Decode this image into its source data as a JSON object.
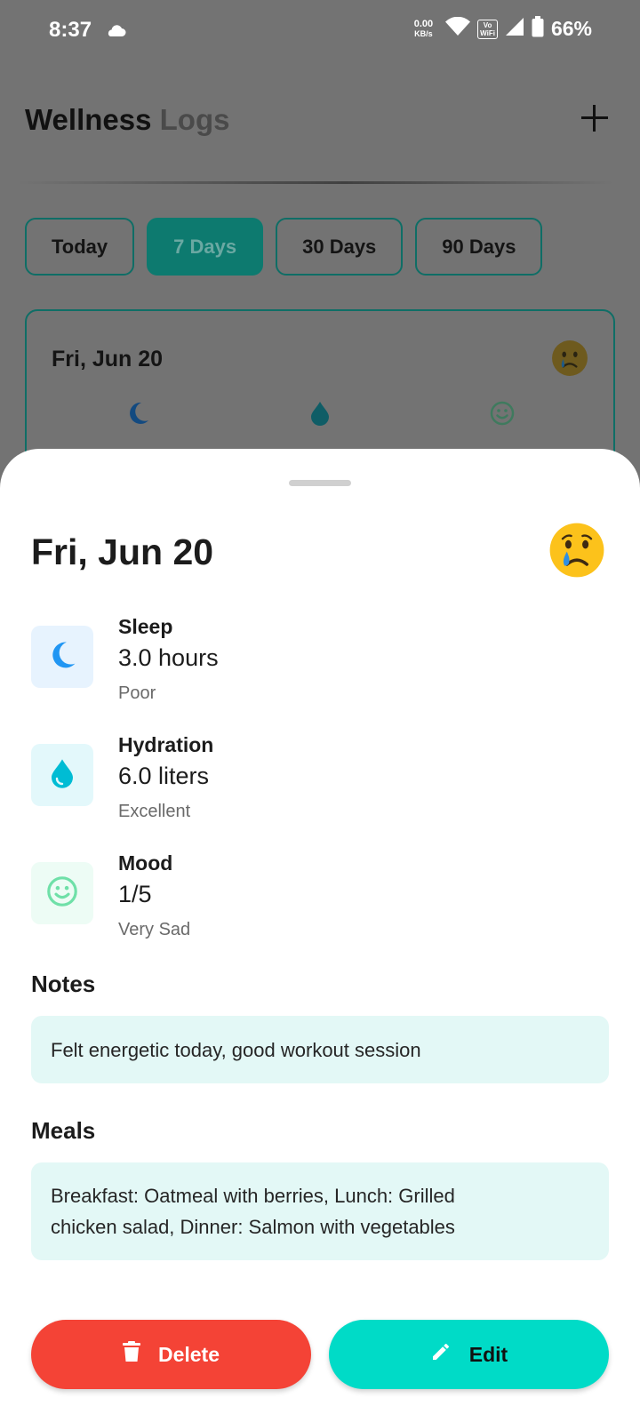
{
  "status_bar": {
    "time": "8:37",
    "net_speed_value": "0.00",
    "net_speed_unit": "KB/s",
    "vowifi_top": "Vo",
    "vowifi_bottom": "WiFi",
    "battery": "66%"
  },
  "header": {
    "title_main": "Wellness",
    "title_muted": "Logs"
  },
  "filters": [
    {
      "label": "Today",
      "active": false
    },
    {
      "label": "7 Days",
      "active": true
    },
    {
      "label": "30 Days",
      "active": false
    },
    {
      "label": "90 Days",
      "active": false
    }
  ],
  "log_card": {
    "date": "Fri, Jun 20",
    "mood_emoji": "crying-face-icon"
  },
  "sheet": {
    "date": "Fri, Jun 20",
    "mood_emoji": "crying-face-icon",
    "metrics": [
      {
        "label": "Sleep",
        "value": "3.0 hours",
        "rating": "Poor",
        "icon": "moon-icon",
        "color": "#2196f3",
        "bg": "#e7f3fe"
      },
      {
        "label": "Hydration",
        "value": "6.0 liters",
        "rating": "Excellent",
        "icon": "water-drop-icon",
        "color": "#00bcd4",
        "bg": "#e3f8fb"
      },
      {
        "label": "Mood",
        "value": "1/5",
        "rating": "Very Sad",
        "icon": "smile-icon",
        "color": "#6fe0a8",
        "bg": "#edfcf5"
      }
    ],
    "notes_title": "Notes",
    "notes_text": "Felt energetic today, good workout session",
    "meals_title": "Meals",
    "meals_line1": "Breakfast: Oatmeal with berries, Lunch: Grilled",
    "meals_line2": "chicken salad, Dinner: Salmon with vegetables",
    "delete_label": "Delete",
    "edit_label": "Edit"
  },
  "colors": {
    "accent": "#00dbc7",
    "danger": "#f44336",
    "scrim": "#737373"
  }
}
